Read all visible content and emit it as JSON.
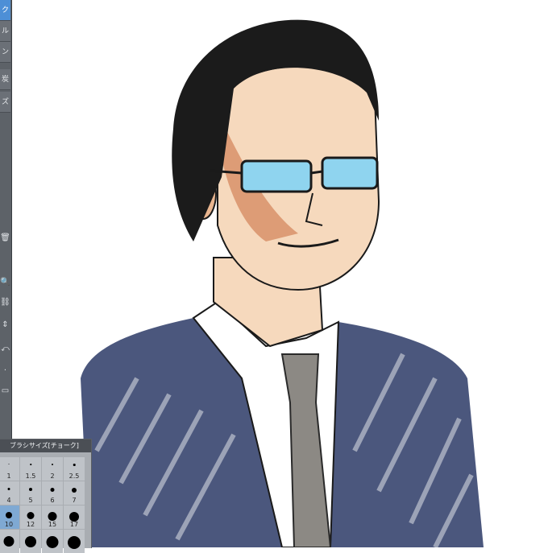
{
  "toolbar": {
    "tabs": [
      {
        "label": "ク",
        "active": true
      },
      {
        "label": "ル",
        "active": false
      },
      {
        "label": "ン",
        "active": false
      },
      {
        "label": "炭",
        "active": false
      },
      {
        "label": "ズ",
        "active": false
      }
    ],
    "tools": [
      {
        "icon": "trash-icon",
        "glyph": "🗑"
      },
      {
        "icon": "zoom-icon",
        "glyph": "🔍"
      },
      {
        "icon": "link-icon",
        "glyph": "⛓"
      },
      {
        "icon": "stepper-icon",
        "glyph": "⇕"
      },
      {
        "icon": "transform-icon",
        "glyph": "⤺"
      },
      {
        "icon": "dot-icon",
        "glyph": "·"
      },
      {
        "icon": "rect-icon",
        "glyph": "▭"
      }
    ]
  },
  "brush_palette": {
    "title": "ブラシサイズ[チョーク]",
    "sizes": [
      {
        "label": "1",
        "dot": 1,
        "selected": false
      },
      {
        "label": "1.5",
        "dot": 1.5,
        "selected": false
      },
      {
        "label": "2",
        "dot": 2,
        "selected": false
      },
      {
        "label": "2.5",
        "dot": 2.5,
        "selected": false
      },
      {
        "label": "4",
        "dot": 3,
        "selected": false
      },
      {
        "label": "5",
        "dot": 4,
        "selected": false
      },
      {
        "label": "6",
        "dot": 5,
        "selected": false
      },
      {
        "label": "7",
        "dot": 6,
        "selected": false
      },
      {
        "label": "10",
        "dot": 8,
        "selected": true
      },
      {
        "label": "12",
        "dot": 9,
        "selected": false
      },
      {
        "label": "15",
        "dot": 11,
        "selected": false
      },
      {
        "label": "17",
        "dot": 12,
        "selected": false
      },
      {
        "label": "",
        "dot": 13,
        "selected": false
      },
      {
        "label": "",
        "dot": 14,
        "selected": false
      },
      {
        "label": "",
        "dot": 15,
        "selected": false
      },
      {
        "label": "",
        "dot": 16,
        "selected": false
      }
    ]
  },
  "colors": {
    "suit": "#2b3a66",
    "tie": "#8c8984",
    "skin": "#f6d9bd",
    "skin_shadow": "#c86a3c",
    "glasses": "#8fd4ef",
    "hair": "#1b1b1b"
  }
}
